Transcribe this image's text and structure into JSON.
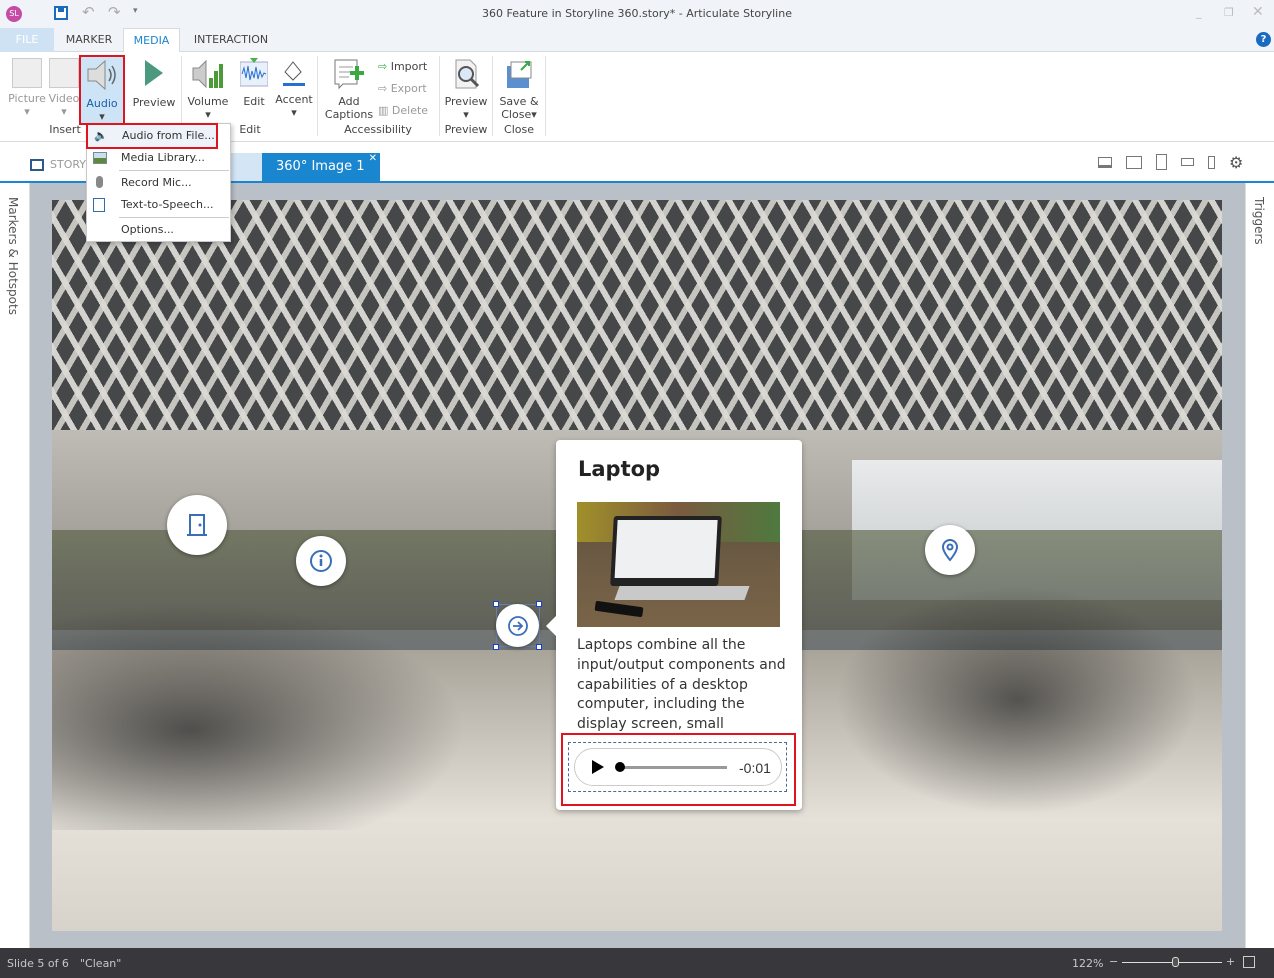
{
  "window": {
    "title": "360 Feature in Storyline 360.story* -  Articulate Storyline",
    "app_icon": "SL"
  },
  "ribbon_tabs": [
    {
      "label": "FILE"
    },
    {
      "label": "MARKER"
    },
    {
      "label": "MEDIA",
      "active": true
    },
    {
      "label": "INTERACTION"
    }
  ],
  "ribbon": {
    "insert": {
      "label": "Insert",
      "picture": "Picture",
      "video": "Video",
      "audio": "Audio"
    },
    "preview_btn": "Preview",
    "edit": {
      "label": "Edit",
      "volume": "Volume",
      "edit": "Edit",
      "accent": "Accent"
    },
    "accessibility": {
      "label": "Accessibility",
      "add_captions": "Add Captions",
      "import": "Import",
      "export": "Export",
      "delete": "Delete"
    },
    "preview": {
      "label": "Preview",
      "button": "Preview"
    },
    "close": {
      "label": "Close",
      "button": "Save & Close"
    }
  },
  "audio_menu": [
    {
      "label": "Audio from File...",
      "highlighted": true
    },
    {
      "label": "Media Library..."
    },
    {
      "label": "Record Mic..."
    },
    {
      "label": "Text-to-Speech..."
    },
    {
      "label": "Options..."
    }
  ],
  "story_tab": "STORY",
  "doc_tab": "360° Image 1",
  "left_panel": "Markers & Hotspots",
  "right_panel": "Triggers",
  "card": {
    "title": "Laptop",
    "body": "Laptops combine all the input/output components and capabilities of a desktop computer, including the display screen, small speakers",
    "audio_time": "-0:01",
    "audio_progress": 0
  },
  "hotspots": [
    {
      "icon": "door-icon"
    },
    {
      "icon": "info-icon"
    },
    {
      "icon": "arrow-right-icon",
      "selected": true
    },
    {
      "icon": "location-pin-icon"
    }
  ],
  "status": {
    "slide": "Slide 5 of 6",
    "theme": "\"Clean\"",
    "zoom": "122%"
  },
  "colors": {
    "accent": "#1a86d0",
    "highlight": "#e0141e",
    "status_bg": "#38373c"
  }
}
